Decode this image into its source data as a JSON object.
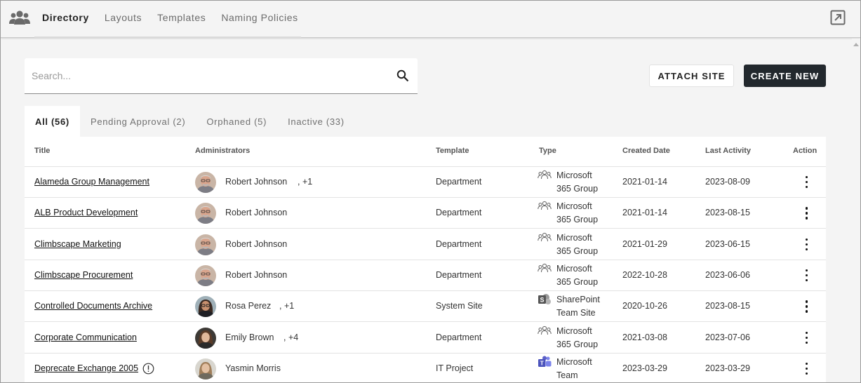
{
  "nav": {
    "app_icon": "people-group-icon",
    "tabs": [
      {
        "label": "Directory",
        "active": true
      },
      {
        "label": "Layouts",
        "active": false
      },
      {
        "label": "Templates",
        "active": false
      },
      {
        "label": "Naming Policies",
        "active": false
      }
    ],
    "open_icon": "open-in-new-icon"
  },
  "search": {
    "placeholder": "Search...",
    "value": "",
    "icon": "search-icon"
  },
  "actions": {
    "attach_label": "ATTACH SITE",
    "create_label": "CREATE NEW"
  },
  "filters": [
    {
      "label": "All (56)",
      "active": true
    },
    {
      "label": "Pending Approval (2)",
      "active": false
    },
    {
      "label": "Orphaned (5)",
      "active": false
    },
    {
      "label": "Inactive (33)",
      "active": false
    }
  ],
  "table": {
    "columns": [
      "Title",
      "Administrators",
      "Template",
      "Type",
      "Created Date",
      "Last Activity",
      "Action"
    ],
    "rows": [
      {
        "title": "Alameda Group Management",
        "admin": "Robert Johnson",
        "extra": ", +1",
        "avatar": "robert",
        "template": "Department",
        "type_icon": "microsoft-365-group-icon",
        "type_line1": "Microsoft",
        "type_line2": "365 Group",
        "created": "2021-01-14",
        "activity": "2023-08-09",
        "warning": false
      },
      {
        "title": "ALB Product Development",
        "admin": "Robert Johnson",
        "extra": "",
        "avatar": "robert",
        "template": "Department",
        "type_icon": "microsoft-365-group-icon",
        "type_line1": "Microsoft",
        "type_line2": "365 Group",
        "created": "2021-01-14",
        "activity": "2023-08-15",
        "warning": false
      },
      {
        "title": "Climbscape Marketing",
        "admin": "Robert Johnson",
        "extra": "",
        "avatar": "robert",
        "template": "Department",
        "type_icon": "microsoft-365-group-icon",
        "type_line1": "Microsoft",
        "type_line2": "365 Group",
        "created": "2021-01-29",
        "activity": "2023-06-15",
        "warning": false
      },
      {
        "title": "Climbscape Procurement",
        "admin": "Robert Johnson",
        "extra": "",
        "avatar": "robert",
        "template": "Department",
        "type_icon": "microsoft-365-group-icon",
        "type_line1": "Microsoft",
        "type_line2": "365 Group",
        "created": "2022-10-28",
        "activity": "2023-06-06",
        "warning": false
      },
      {
        "title": "Controlled Documents Archive",
        "admin": "Rosa Perez",
        "extra": ", +1",
        "avatar": "rosa",
        "template": "System Site",
        "type_icon": "sharepoint-icon",
        "type_line1": "SharePoint",
        "type_line2": "Team Site",
        "created": "2020-10-26",
        "activity": "2023-08-15",
        "warning": false
      },
      {
        "title": "Corporate Communication",
        "admin": "Emily Brown",
        "extra": ", +4",
        "avatar": "emily",
        "template": "Department",
        "type_icon": "microsoft-365-group-icon",
        "type_line1": "Microsoft",
        "type_line2": "365 Group",
        "created": "2021-03-08",
        "activity": "2023-07-06",
        "warning": false
      },
      {
        "title": "Deprecate Exchange 2005",
        "admin": "Yasmin Morris",
        "extra": "",
        "avatar": "yasmin",
        "template": "IT Project",
        "type_icon": "microsoft-teams-icon",
        "type_line1": "Microsoft",
        "type_line2": "Team",
        "created": "2023-03-29",
        "activity": "2023-03-29",
        "warning": true
      }
    ]
  },
  "colors": {
    "primary_button": "#22282d",
    "page_bg": "#f4f4f4",
    "teams": "#5b5fc7",
    "sharepoint": "#555555"
  }
}
